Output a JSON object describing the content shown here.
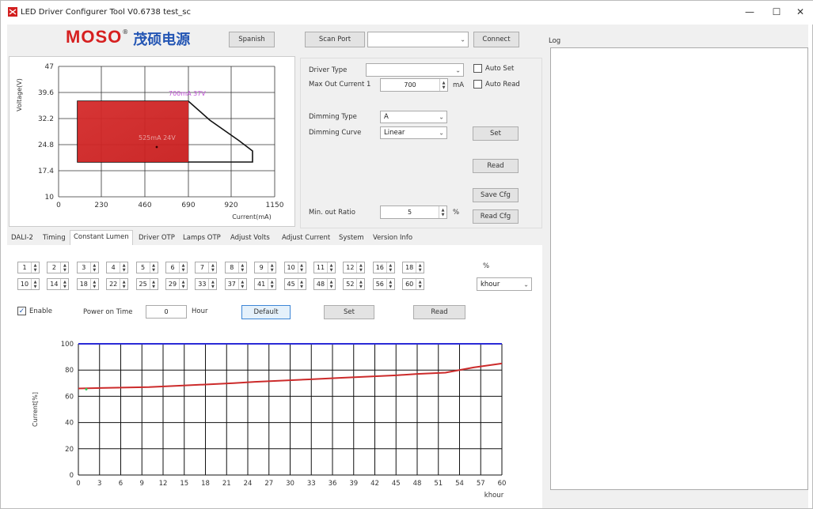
{
  "window": {
    "title": "LED Driver Configurer Tool V0.6738  test_sc",
    "minimize": "—",
    "maximize": "☐",
    "close": "✕"
  },
  "header": {
    "brand_latin": "MOSO",
    "brand_cn": "茂硕电源",
    "registered": "®",
    "spanish_label": "Spanish",
    "scan_port_label": "Scan Port",
    "port_value": "",
    "connect_label": "Connect"
  },
  "top_chart": {
    "ylabel": "Voltage(V)",
    "xlabel": "Current(mA)",
    "y_ticks": [
      "47",
      "39.6",
      "32.2",
      "24.8",
      "17.4",
      "10"
    ],
    "x_ticks": [
      "0",
      "230",
      "460",
      "690",
      "920",
      "1150"
    ],
    "annot_max": "700mA 37V",
    "annot_set": "525mA 24V",
    "accent_color": "#c81e1e"
  },
  "driver": {
    "driver_type_label": "Driver Type",
    "driver_type_value": "",
    "auto_set_label": "Auto Set",
    "max_out_label": "Max Out Current 1",
    "max_out_value": "700",
    "max_out_unit": "mA",
    "auto_read_label": "Auto Read",
    "dimming_type_label": "Dimming Type",
    "dimming_type_value": "A",
    "dimming_curve_label": "Dimming Curve",
    "dimming_curve_value": "Linear",
    "set_label": "Set",
    "read_label": "Read",
    "save_cfg_label": "Save Cfg",
    "read_cfg_label": "Read Cfg",
    "min_out_label": "Min. out Ratio",
    "min_out_value": "5",
    "min_out_unit": "%"
  },
  "tabs": [
    "DALI-2",
    "Timing",
    "Constant Lumen",
    "Driver OTP",
    "Lamps OTP",
    "Adjust Volts",
    "Adjust Current",
    "System",
    "Version Info"
  ],
  "cl": {
    "row1": [
      "1",
      "2",
      "3",
      "4",
      "5",
      "6",
      "7",
      "8",
      "9",
      "10",
      "11",
      "12",
      "16",
      "18"
    ],
    "row1_unit": "%",
    "row2": [
      "10",
      "14",
      "18",
      "22",
      "25",
      "29",
      "33",
      "37",
      "41",
      "45",
      "48",
      "52",
      "56",
      "60"
    ],
    "row2_unit": "khour",
    "enable_label": "Enable",
    "power_on_label": "Power on Time",
    "power_on_value": "0",
    "hour_label": "Hour",
    "default_label": "Default",
    "set_label": "Set",
    "read_label": "Read"
  },
  "chart_data": {
    "type": "line",
    "ylabel": "Current[%]",
    "xlabel": "khour",
    "x_ticks": [
      0,
      3,
      6,
      9,
      12,
      15,
      18,
      21,
      24,
      27,
      30,
      33,
      36,
      39,
      42,
      45,
      48,
      51,
      54,
      57,
      60
    ],
    "y_ticks": [
      0,
      20,
      40,
      60,
      80,
      100
    ],
    "xlim": [
      0,
      60
    ],
    "ylim": [
      0,
      100
    ],
    "grid": true,
    "series": [
      {
        "color": "#cc2b2b",
        "x": [
          0,
          10,
          14,
          18,
          22,
          25,
          29,
          33,
          37,
          41,
          45,
          48,
          52,
          56,
          60
        ],
        "y": [
          66,
          67,
          68,
          69,
          70,
          71,
          72,
          73,
          74,
          75,
          76,
          77,
          78,
          82,
          85
        ]
      },
      {
        "color": "#2a2ad6",
        "x": [
          0,
          60
        ],
        "y": [
          100,
          100
        ]
      }
    ]
  },
  "log": {
    "label": "Log"
  }
}
